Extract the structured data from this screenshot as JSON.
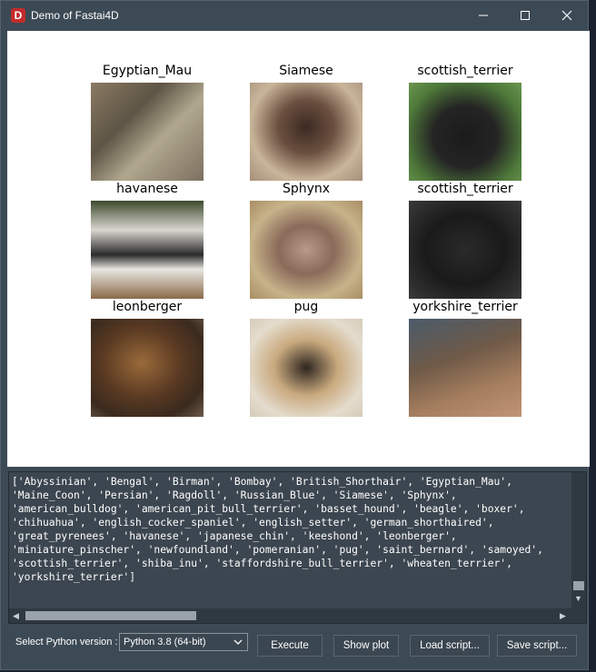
{
  "window": {
    "icon_letter": "D",
    "title": "Demo of Fastai4D",
    "minimize": "—",
    "maximize": "☐",
    "close": "✕"
  },
  "grid": [
    {
      "label": "Egyptian_Mau",
      "image": "cat-photo"
    },
    {
      "label": "Siamese",
      "image": "cat-photo"
    },
    {
      "label": "scottish_terrier",
      "image": "dog-photo"
    },
    {
      "label": "havanese",
      "image": "dog-photo"
    },
    {
      "label": "Sphynx",
      "image": "cat-photo"
    },
    {
      "label": "scottish_terrier",
      "image": "dog-photo"
    },
    {
      "label": "leonberger",
      "image": "dog-photo"
    },
    {
      "label": "pug",
      "image": "dog-photo"
    },
    {
      "label": "yorkshire_terrier",
      "image": "dog-photo"
    }
  ],
  "console": {
    "lines": [
      "['Abyssinian', 'Bengal', 'Birman', 'Bombay', 'British_Shorthair', 'Egyptian_Mau',",
      "'Maine_Coon', 'Persian', 'Ragdoll', 'Russian_Blue', 'Siamese', 'Sphynx',",
      "'american_bulldog', 'american_pit_bull_terrier', 'basset_hound', 'beagle', 'boxer',",
      "'chihuahua', 'english_cocker_spaniel', 'english_setter', 'german_shorthaired',",
      "'great_pyrenees', 'havanese', 'japanese_chin', 'keeshond', 'leonberger',",
      "'miniature_pinscher', 'newfoundland', 'pomeranian', 'pug', 'saint_bernard', 'samoyed',",
      "'scottish_terrier', 'shiba_inu', 'staffordshire_bull_terrier', 'wheaten_terrier',",
      "'yorkshire_terrier']"
    ]
  },
  "controls": {
    "select_label": "Select Python version :",
    "python_version": "Python 3.8 (64-bit)",
    "execute": "Execute",
    "show_plot": "Show plot",
    "load_script": "Load script...",
    "save_script": "Save script..."
  }
}
